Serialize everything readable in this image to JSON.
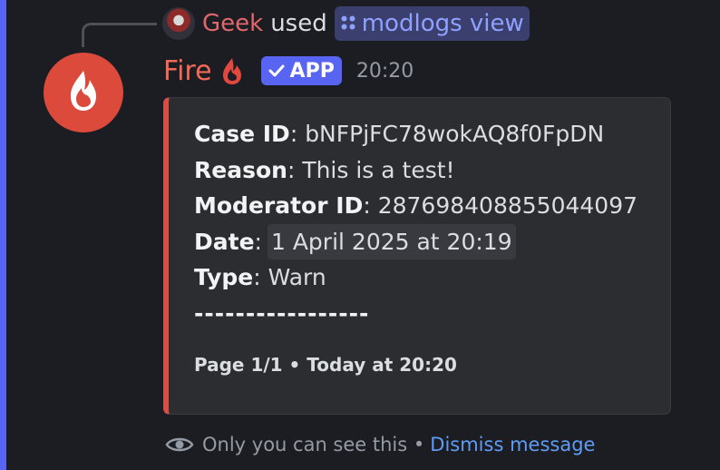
{
  "reply": {
    "username": "Geek",
    "verb": "used",
    "command_icon": "app-command-icon",
    "command": "modlogs view"
  },
  "message": {
    "bot_name": "Fire",
    "bot_name_icon": "fire-icon",
    "app_badge": "APP",
    "timestamp": "20:20",
    "avatar_icon": "fire-icon"
  },
  "embed": {
    "accent_color": "#d94e42",
    "fields": [
      {
        "label": "Case ID",
        "value": "bNFPjFC78wokAQ8f0FpDN"
      },
      {
        "label": "Reason",
        "value": "This is a test!"
      },
      {
        "label": "Moderator ID",
        "value": "287698408855044097"
      },
      {
        "label": "Date",
        "value": "1 April 2025 at 20:19"
      },
      {
        "label": "Type",
        "value": "Warn"
      }
    ],
    "separator": "-----------------",
    "footer": "Page 1/1 • Today at 20:20"
  },
  "ephemeral": {
    "icon": "eye-icon",
    "notice": "Only you can see this •",
    "dismiss": "Dismiss message"
  },
  "colors": {
    "background": "#1c1d23",
    "brand": "#5865f2",
    "link": "#5f9cf5"
  }
}
